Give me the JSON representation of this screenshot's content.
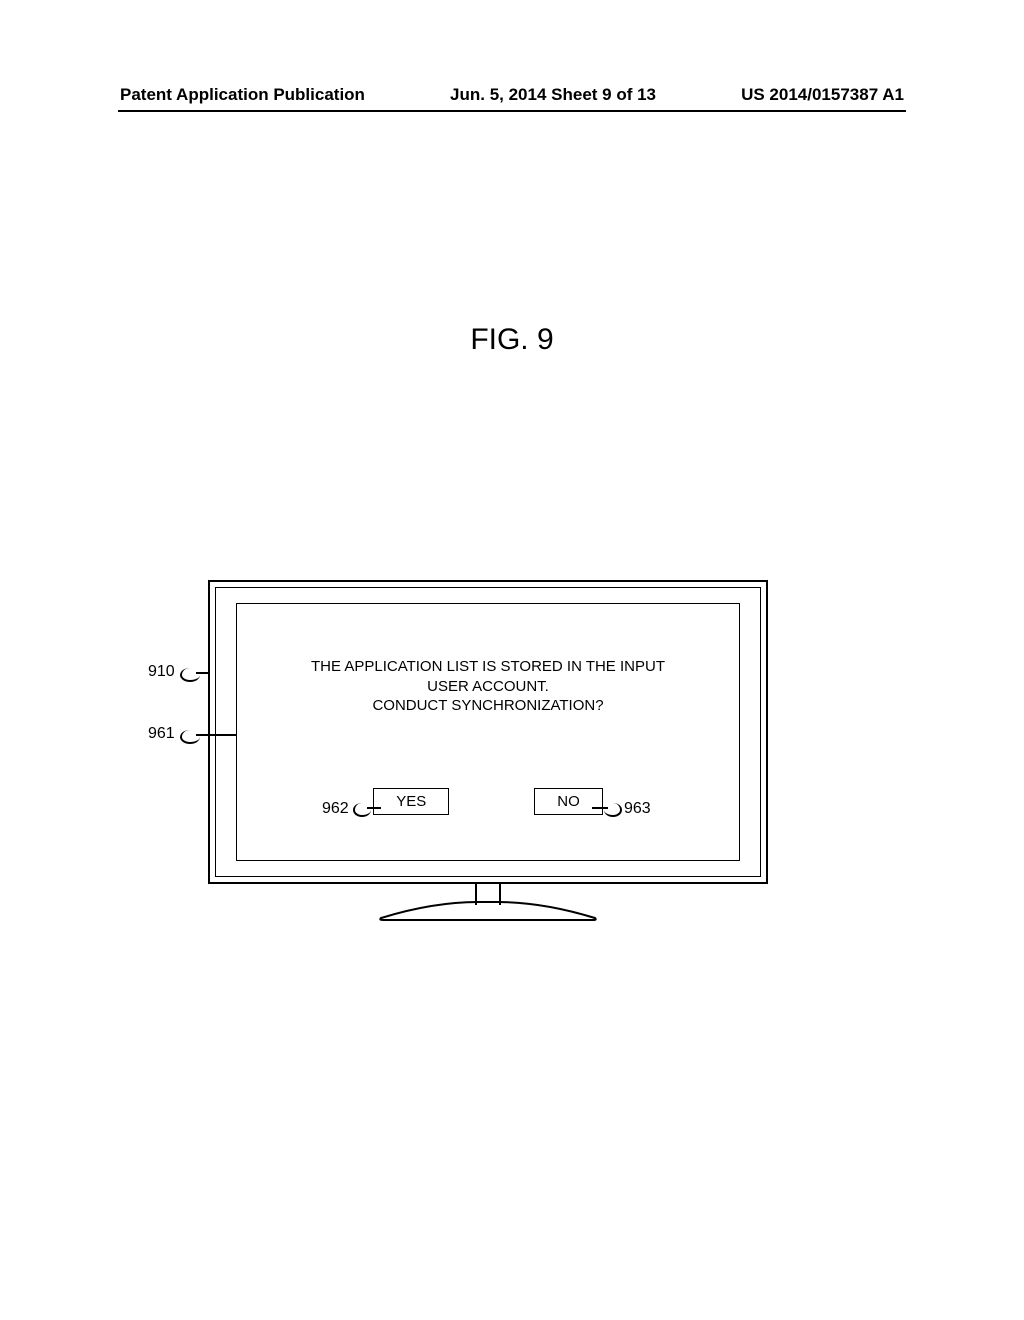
{
  "header": {
    "left": "Patent Application Publication",
    "center": "Jun. 5, 2014  Sheet 9 of 13",
    "right": "US 2014/0157387 A1"
  },
  "figure_title": "FIG. 9",
  "dialog": {
    "line1": "THE APPLICATION LIST IS STORED IN THE INPUT",
    "line2": "USER ACCOUNT.",
    "line3": "CONDUCT SYNCHRONIZATION?",
    "yes_label": "YES",
    "no_label": "NO"
  },
  "references": {
    "r910": "910",
    "r961": "961",
    "r962": "962",
    "r963": "963"
  }
}
